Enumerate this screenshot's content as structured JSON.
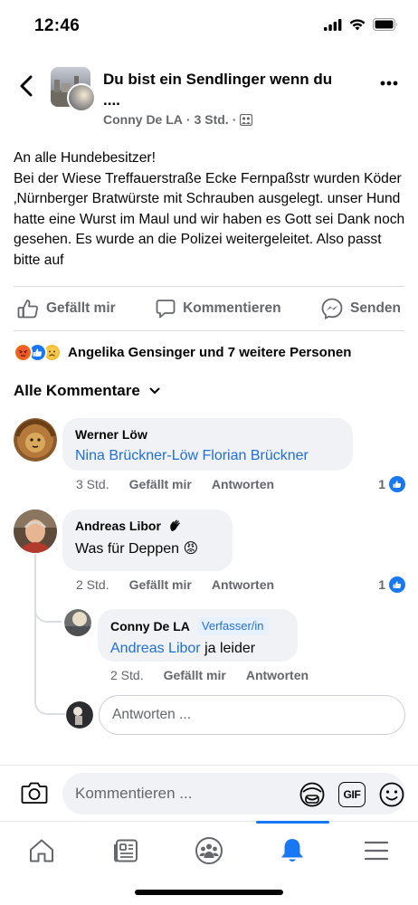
{
  "status_bar": {
    "time": "12:46"
  },
  "header": {
    "group_title": "Du bist ein Sendlinger wenn du ....",
    "author": "Conny De LA",
    "time": "3 Std.",
    "separator": "·"
  },
  "post": {
    "text": "An alle Hundebesitzer!\n Bei der Wiese Treffauerstraße Ecke Fernpaßstr wurden Köder ‚Nürnberger Bratwürste mit Schrauben ausgelegt. unser Hund hatte eine Wurst im Maul und wir haben es Gott sei Dank noch gesehen.  Es wurde an die Polizei weitergeleitet.  Also passt bitte auf"
  },
  "actions": {
    "like": "Gefällt mir",
    "comment": "Kommentieren",
    "send": "Senden"
  },
  "reactions": {
    "summary": "Angelika Gensinger und 7 weitere Personen",
    "types": [
      "angry",
      "like",
      "sad"
    ]
  },
  "comments_header": {
    "label": "Alle Kommentare"
  },
  "comments": [
    {
      "author": "Werner Löw",
      "tags": "Nina Brückner-Löw Florian Brückner",
      "time": "3 Std.",
      "like": "Gefällt mir",
      "reply": "Antworten",
      "like_count": "1"
    },
    {
      "author": "Andreas Libor",
      "author_badge": "👋",
      "text": "Was für Deppen 😡",
      "time": "2 Std.",
      "like": "Gefällt mir",
      "reply": "Antworten",
      "like_count": "1",
      "replies": [
        {
          "author": "Conny De LA",
          "badge": "Verfasser/in",
          "tag": "Andreas Libor",
          "text": " ja leider",
          "time": "2 Std.",
          "like": "Gefällt mir",
          "reply": "Antworten"
        }
      ]
    }
  ],
  "reply_input": {
    "placeholder": "Antworten ..."
  },
  "composer": {
    "placeholder": "Kommentieren ...",
    "gif_label": "GIF"
  },
  "colors": {
    "accent": "#1877f2",
    "text_secondary": "#65676b",
    "bubble": "#f0f2f5",
    "tag": "#216fdb"
  }
}
